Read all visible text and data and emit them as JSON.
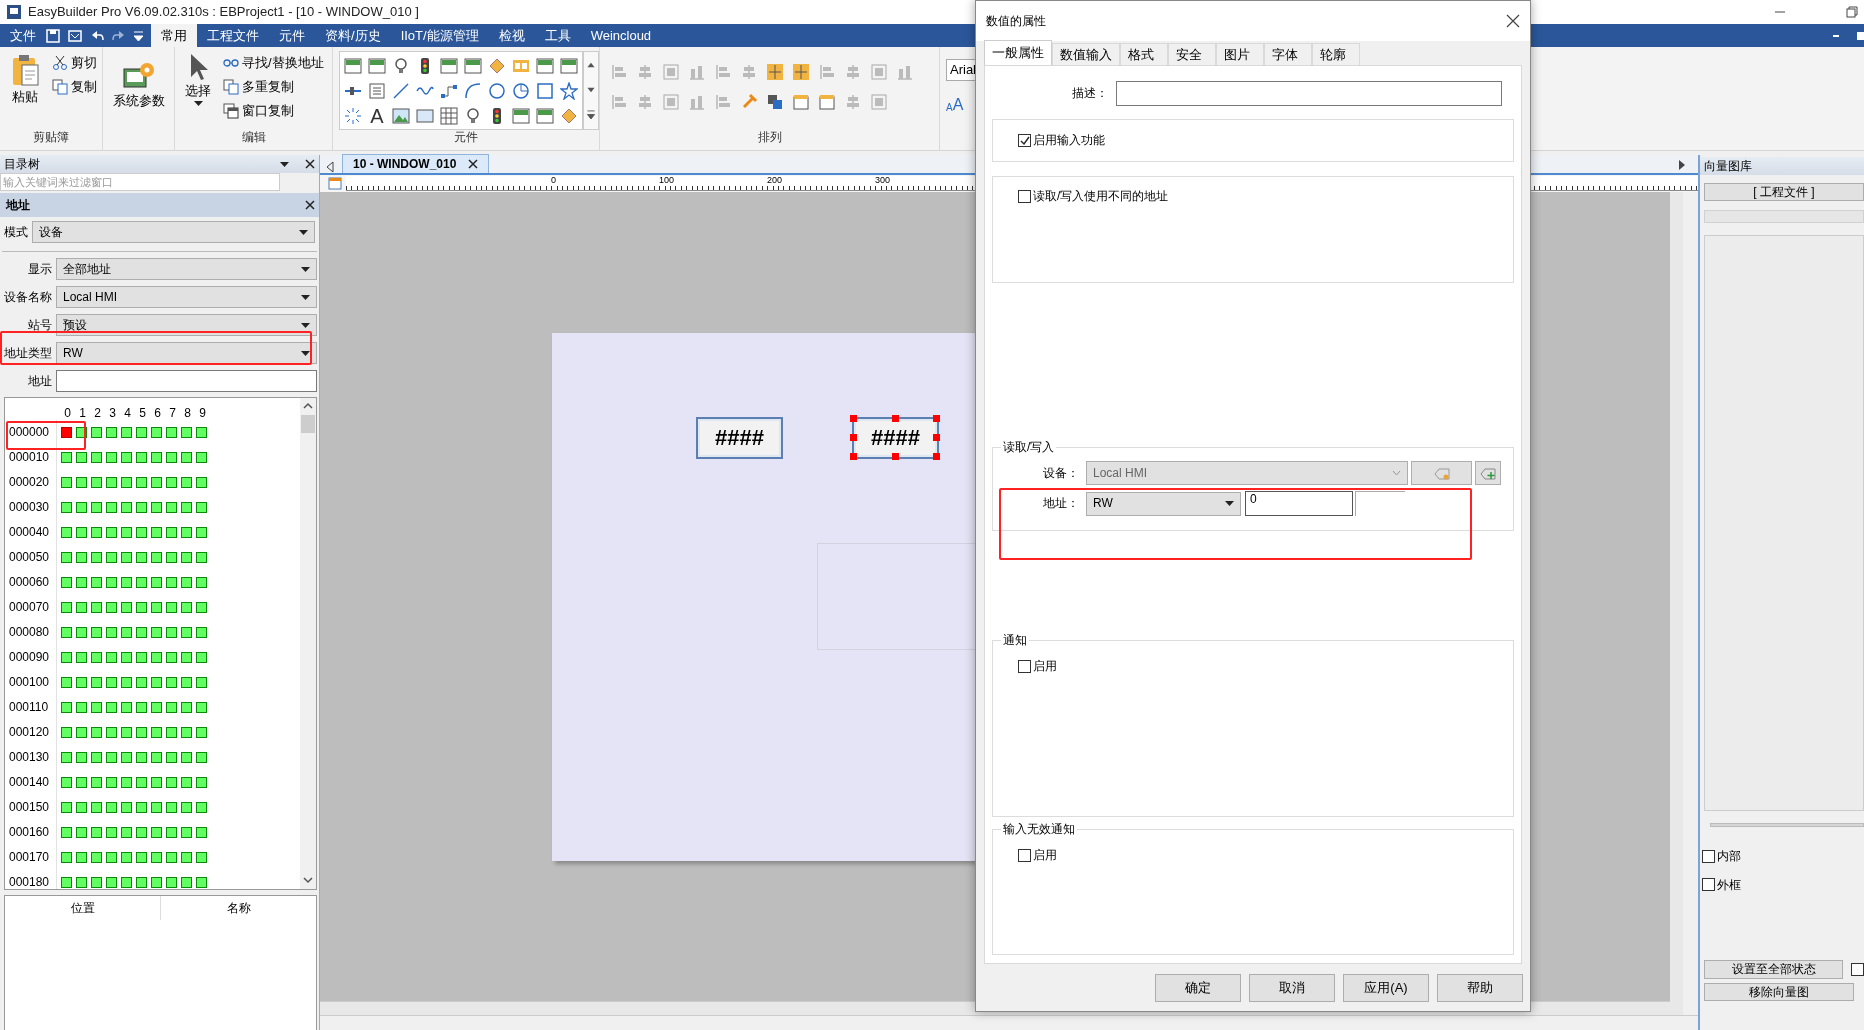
{
  "window": {
    "title": "EasyBuilder Pro V6.09.02.310s : EBProject1 - [10 - WINDOW_010 ]"
  },
  "menu": {
    "file": "文件",
    "tabs": [
      {
        "label": "常用",
        "selected": true
      },
      {
        "label": "工程文件",
        "selected": false
      },
      {
        "label": "元件",
        "selected": false
      },
      {
        "label": "资料/历史",
        "selected": false
      },
      {
        "label": "IIoT/能源管理",
        "selected": false
      },
      {
        "label": "检视",
        "selected": false
      },
      {
        "label": "工具",
        "selected": false
      },
      {
        "label": "Weincloud",
        "selected": false
      }
    ]
  },
  "ribbon": {
    "paste": "粘贴",
    "cut": "剪切",
    "copy": "复制",
    "clipboard_caption": "剪贴簿",
    "system_parameters": "系统参数",
    "select": "选择",
    "find_replace": "寻找/替换地址",
    "multi_copy": "多重复制",
    "window_copy": "窗口复制",
    "edit_caption": "编辑",
    "text_tool": "A",
    "objects_caption": "元件",
    "arrange_caption": "排列",
    "font": "Arial",
    "font_grow": [
      "A",
      "A"
    ]
  },
  "directory_tree": {
    "title": "目录树",
    "filter_placeholder": "输入关键词来过滤窗口"
  },
  "address_panel": {
    "title": "地址",
    "mode": {
      "label": "模式",
      "value": "设备"
    },
    "fields": [
      {
        "label": "显示",
        "value": "全部地址",
        "kind": "select"
      },
      {
        "label": "设备名称",
        "value": "Local HMI",
        "kind": "select"
      },
      {
        "label": "站号",
        "value": "预设",
        "kind": "select"
      },
      {
        "label": "地址类型",
        "value": "RW",
        "kind": "select"
      },
      {
        "label": "地址",
        "kind": "input"
      }
    ],
    "columns": [
      "0",
      "1",
      "2",
      "3",
      "4",
      "5",
      "6",
      "7",
      "8",
      "9"
    ],
    "rows": [
      {
        "address": "000000",
        "bits": [
          true,
          false,
          false,
          false,
          false,
          false,
          false,
          false,
          false,
          false
        ]
      },
      {
        "address": "000010",
        "bits": [
          false,
          false,
          false,
          false,
          false,
          false,
          false,
          false,
          false,
          false
        ]
      },
      {
        "address": "000020",
        "bits": [
          false,
          false,
          false,
          false,
          false,
          false,
          false,
          false,
          false,
          false
        ]
      },
      {
        "address": "000030",
        "bits": [
          false,
          false,
          false,
          false,
          false,
          false,
          false,
          false,
          false,
          false
        ]
      },
      {
        "address": "000040",
        "bits": [
          false,
          false,
          false,
          false,
          false,
          false,
          false,
          false,
          false,
          false
        ]
      },
      {
        "address": "000050",
        "bits": [
          false,
          false,
          false,
          false,
          false,
          false,
          false,
          false,
          false,
          false
        ]
      },
      {
        "address": "000060",
        "bits": [
          false,
          false,
          false,
          false,
          false,
          false,
          false,
          false,
          false,
          false
        ]
      },
      {
        "address": "000070",
        "bits": [
          false,
          false,
          false,
          false,
          false,
          false,
          false,
          false,
          false,
          false
        ]
      },
      {
        "address": "000080",
        "bits": [
          false,
          false,
          false,
          false,
          false,
          false,
          false,
          false,
          false,
          false
        ]
      },
      {
        "address": "000090",
        "bits": [
          false,
          false,
          false,
          false,
          false,
          false,
          false,
          false,
          false,
          false
        ]
      },
      {
        "address": "000100",
        "bits": [
          false,
          false,
          false,
          false,
          false,
          false,
          false,
          false,
          false,
          false
        ]
      },
      {
        "address": "000110",
        "bits": [
          false,
          false,
          false,
          false,
          false,
          false,
          false,
          false,
          false,
          false
        ]
      },
      {
        "address": "000120",
        "bits": [
          false,
          false,
          false,
          false,
          false,
          false,
          false,
          false,
          false,
          false
        ]
      },
      {
        "address": "000130",
        "bits": [
          false,
          false,
          false,
          false,
          false,
          false,
          false,
          false,
          false,
          false
        ]
      },
      {
        "address": "000140",
        "bits": [
          false,
          false,
          false,
          false,
          false,
          false,
          false,
          false,
          false,
          false
        ]
      },
      {
        "address": "000150",
        "bits": [
          false,
          false,
          false,
          false,
          false,
          false,
          false,
          false,
          false,
          false
        ]
      },
      {
        "address": "000160",
        "bits": [
          false,
          false,
          false,
          false,
          false,
          false,
          false,
          false,
          false,
          false
        ]
      },
      {
        "address": "000170",
        "bits": [
          false,
          false,
          false,
          false,
          false,
          false,
          false,
          false,
          false,
          false
        ]
      },
      {
        "address": "000180",
        "bits": [
          false,
          false,
          false,
          false,
          false,
          false,
          false,
          false,
          false,
          false
        ]
      }
    ],
    "table_columns": [
      "位置",
      "名称"
    ]
  },
  "editor": {
    "tab": "10 - WINDOW_010",
    "ruler_labels": [
      "0",
      "100",
      "200",
      "300"
    ],
    "objects": [
      {
        "text": "####",
        "selected": false
      },
      {
        "text": "####",
        "selected": true
      }
    ]
  },
  "vector_library": {
    "title": "向量图库",
    "source_button": "[ 工程文件 ]",
    "checkboxes": [
      {
        "label": "内部",
        "checked": false
      },
      {
        "label": "外框",
        "checked": false
      }
    ],
    "apply_button": "设置至全部状态",
    "apply_checkbox": {
      "checked": false
    },
    "remove_button": "移除向量图"
  },
  "dialog": {
    "title": "数值的属性",
    "tabs": [
      {
        "label": "一般属性",
        "selected": true
      },
      {
        "label": "数值输入",
        "selected": false
      },
      {
        "label": "格式",
        "selected": false
      },
      {
        "label": "安全",
        "selected": false
      },
      {
        "label": "图片",
        "selected": false
      },
      {
        "label": "字体",
        "selected": false
      },
      {
        "label": "轮廓",
        "selected": false
      }
    ],
    "description_label": "描述：",
    "enable_input": {
      "label": "启用输入功能",
      "checked": true
    },
    "different_address": {
      "label": "读取/写入使用不同的地址",
      "checked": false
    },
    "read_write": {
      "title": "读取/写入",
      "device_label": "设备：",
      "device": "Local HMI",
      "address_label": "地址：",
      "address_type": "RW",
      "address": "0"
    },
    "notify": {
      "title": "通知",
      "enable": {
        "label": "启用",
        "checked": false
      }
    },
    "invalid_notify": {
      "title": "输入无效通知",
      "enable": {
        "label": "启用",
        "checked": false
      }
    },
    "buttons": [
      "确定",
      "取消",
      "应用(A)",
      "帮助"
    ]
  }
}
